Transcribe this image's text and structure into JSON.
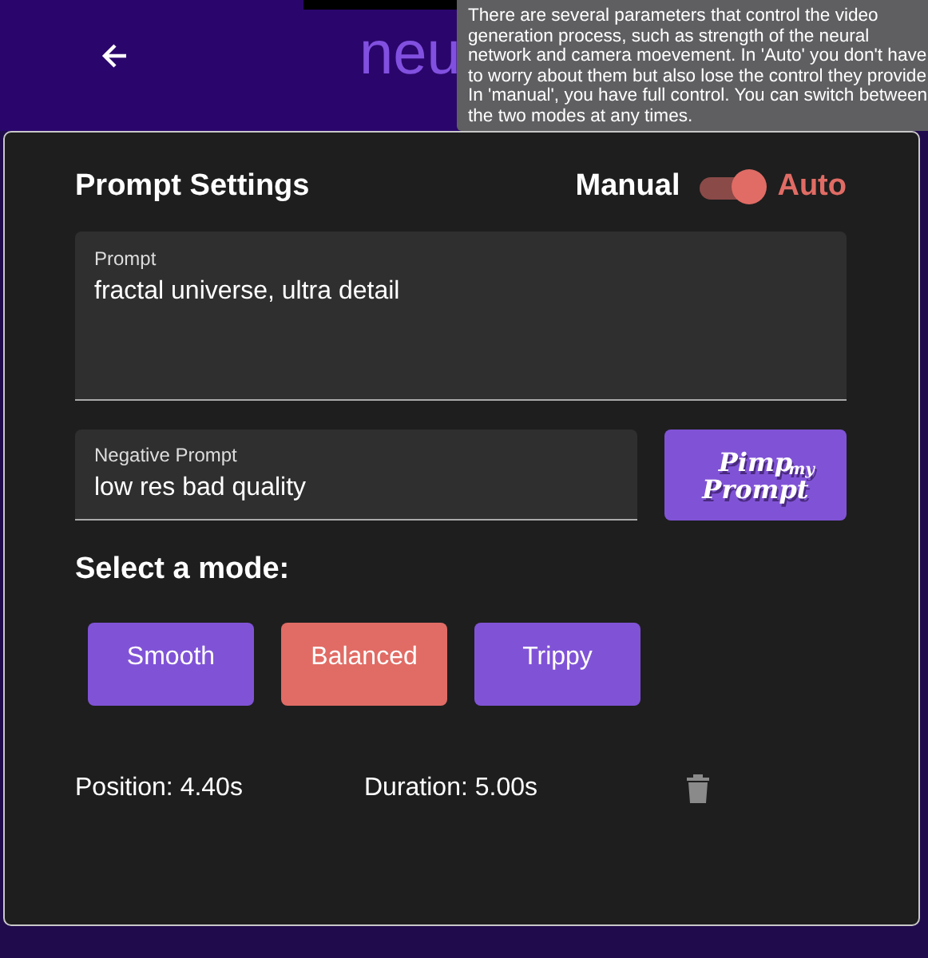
{
  "header": {
    "title": "neu"
  },
  "tooltip": {
    "text": "There are several parameters that control the video generation process, such as strength of the neural network and camera moevement. In 'Auto' you don't have to worry about them but also lose the control they provide In 'manual', you have full control. You can switch between the two modes at any times."
  },
  "settings": {
    "title": "Prompt Settings",
    "toggle": {
      "off_label": "Manual",
      "on_label": "Auto",
      "on": true
    },
    "prompt": {
      "label": "Prompt",
      "value": "fractal universe, ultra detail"
    },
    "negative_prompt": {
      "label": "Negative Prompt",
      "value": "low res bad quality"
    },
    "pimp_button": {
      "line_1": "Pimp",
      "line_2": "my",
      "line_3": "Prompt"
    },
    "mode_heading": "Select a mode:",
    "modes": [
      {
        "label": "Smooth",
        "selected": false
      },
      {
        "label": "Balanced",
        "selected": true
      },
      {
        "label": "Trippy",
        "selected": false
      }
    ],
    "position": "Position: 4.40s",
    "duration": "Duration: 5.00s"
  }
}
